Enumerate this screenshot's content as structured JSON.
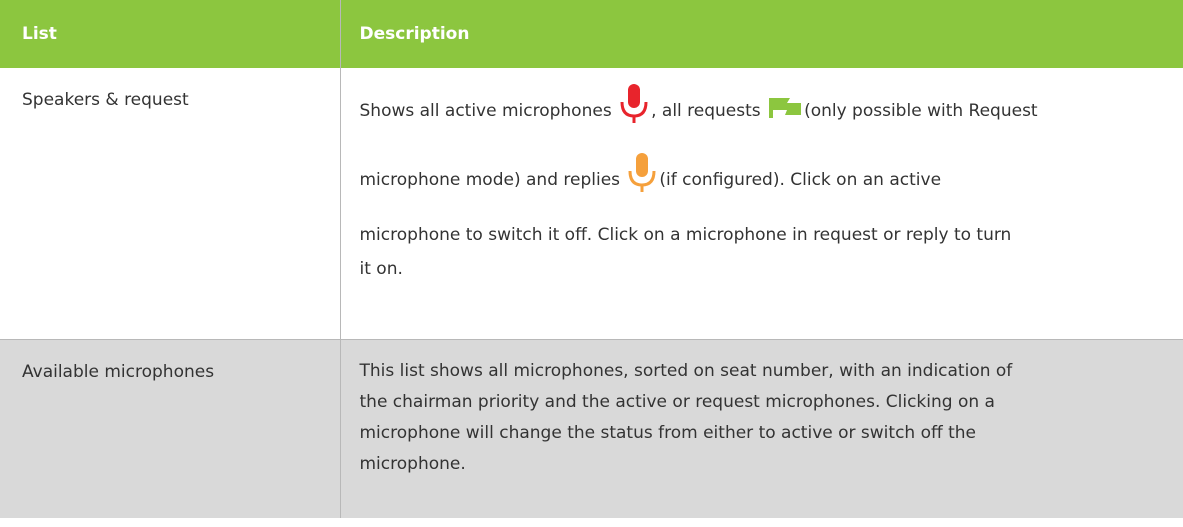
{
  "table": {
    "headers": {
      "list": "List",
      "description": "Description"
    },
    "rows": [
      {
        "list": "Speakers & request",
        "description": {
          "line1_a": "Shows all active microphones ",
          "line1_b": ", all requests ",
          "line1_c": "(only possible with Request",
          "line2_a": "microphone mode) and replies ",
          "line2_b": "(if configured). Click on an active",
          "line3": "microphone to switch it off. Click on a microphone in request or reply to turn",
          "line4": "it on."
        },
        "icons": {
          "active": {
            "name": "red-microphone-icon",
            "color": "#e8242c"
          },
          "request": {
            "name": "green-flag-icon",
            "color": "#8cc63f"
          },
          "reply": {
            "name": "orange-microphone-icon",
            "color": "#f5a03c"
          }
        }
      },
      {
        "list": "Available microphones",
        "description": {
          "line1": "This list shows all microphones, sorted on seat number, with an indication of",
          "line2": "the chairman priority and the active or request microphones. Clicking on a",
          "line3": "microphone will change the status from either to active or switch off the",
          "line4": "microphone."
        }
      }
    ]
  },
  "colors": {
    "header_bg": "#8cc63f",
    "alt_row_bg": "#d9d9d9",
    "text": "#333333"
  }
}
